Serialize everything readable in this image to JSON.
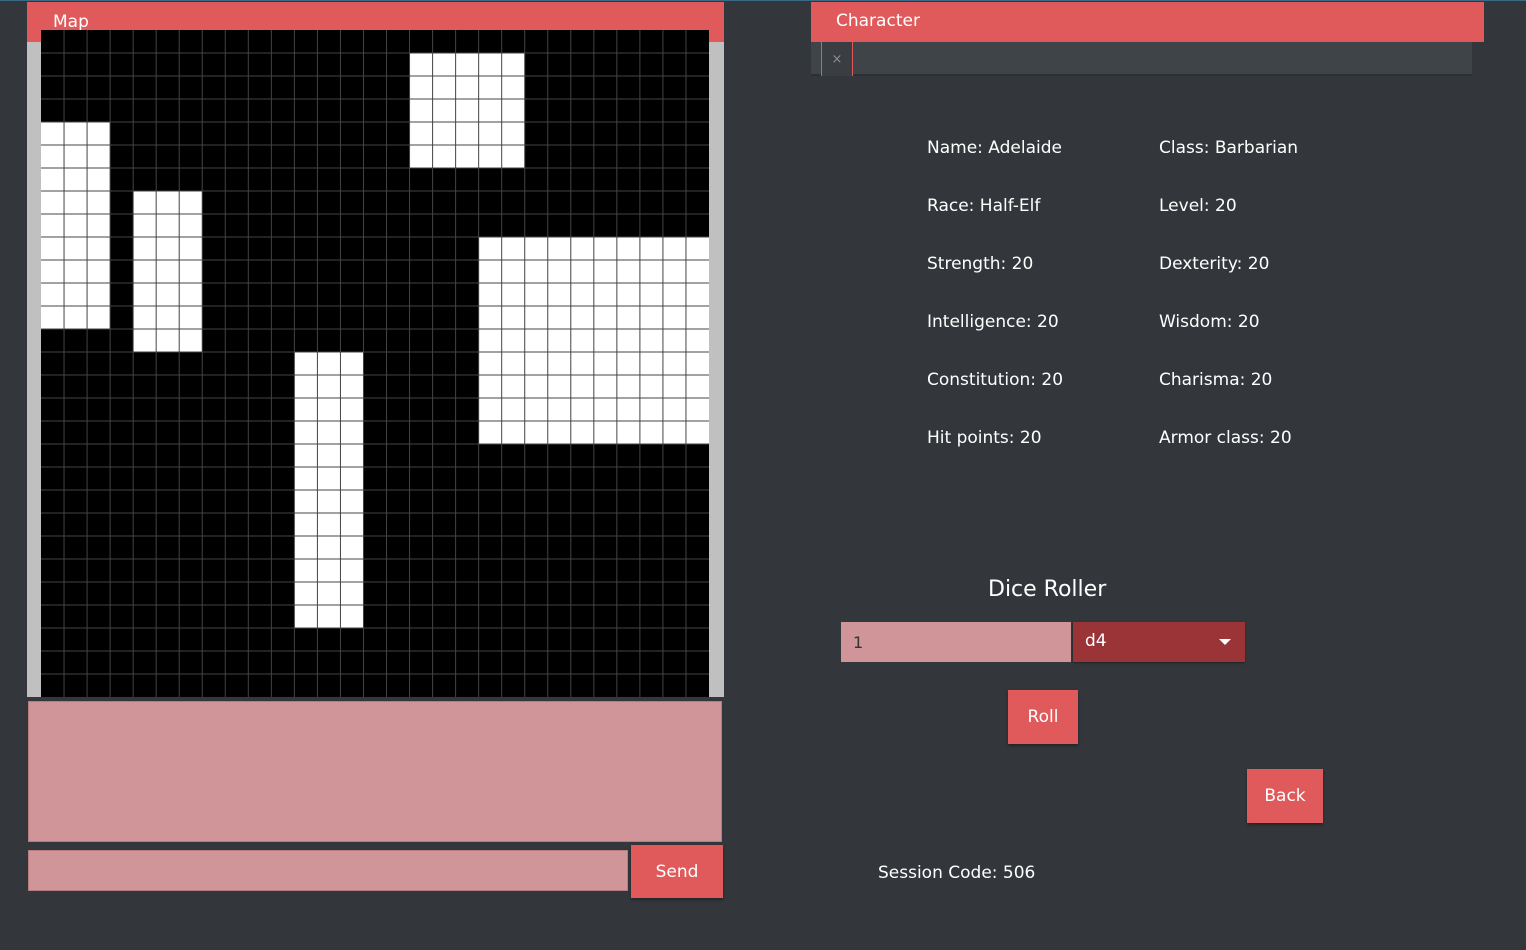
{
  "map": {
    "title": "Map",
    "grid": {
      "cols": 29,
      "rows": 29,
      "wall_color": "#000000",
      "floor_color": "#ffffff",
      "line_color": "#444444",
      "floor_rects": [
        [
          0,
          4,
          3,
          9
        ],
        [
          4,
          7,
          3,
          7
        ],
        [
          16,
          1,
          5,
          5
        ],
        [
          19,
          9,
          10,
          9
        ],
        [
          11,
          14,
          3,
          12
        ]
      ]
    }
  },
  "chat": {
    "send_label": "Send"
  },
  "character": {
    "title": "Character",
    "close_tab_glyph": "×",
    "stats": {
      "name": "Name: Adelaide",
      "class": "Class: Barbarian",
      "race": "Race: Half-Elf",
      "level": "Level: 20",
      "strength": "Strength: 20",
      "dexterity": "Dexterity: 20",
      "intelligence": "Intelligence: 20",
      "wisdom": "Wisdom: 20",
      "constitution": "Constitution: 20",
      "charisma": "Charisma: 20",
      "hit_points": "Hit points: 20",
      "armor_class": "Armor class: 20"
    }
  },
  "dice": {
    "title": "Dice Roller",
    "count_value": "1",
    "die_selected": "d4",
    "roll_label": "Roll"
  },
  "back_label": "Back",
  "session_code": "Session Code: 506",
  "colors": {
    "accent": "#e05a5c",
    "background": "#33373b",
    "input_fill": "#cf9598",
    "select_fill": "#9b3437"
  }
}
